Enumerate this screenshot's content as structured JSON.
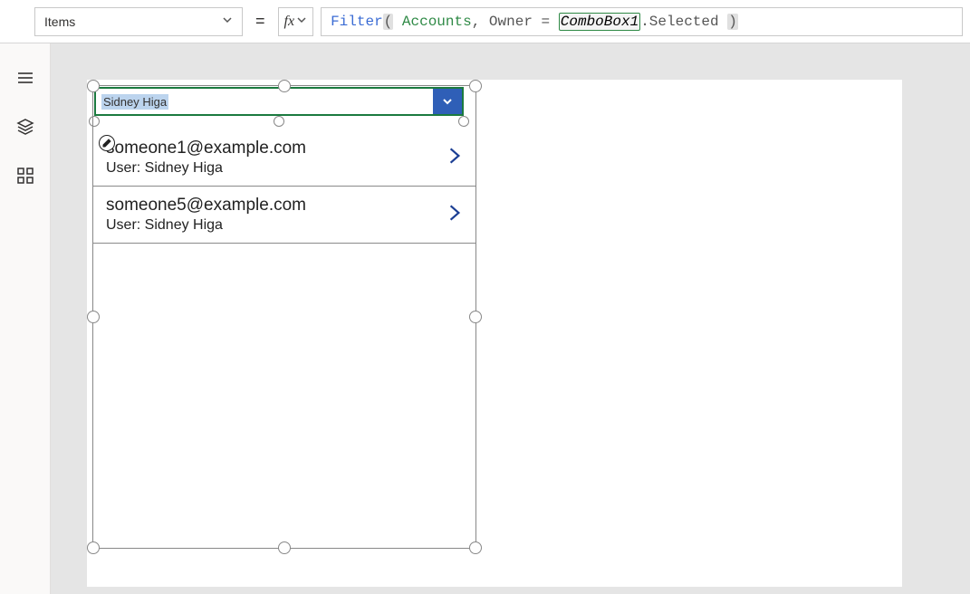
{
  "formulaBar": {
    "property": "Items",
    "equals": "=",
    "fxLabel": "fx",
    "formula": {
      "fn": "Filter",
      "openParen": "(",
      "arg1": "Accounts",
      "comma1": ",",
      "ownerKey": "Owner",
      "eq": "=",
      "comboRef": "ComboBox1",
      "dot": ".",
      "selectedProp": "Selected",
      "closeParen": ")"
    }
  },
  "leftRail": {
    "icons": [
      "hamburger-icon",
      "layers-icon",
      "apps-icon"
    ]
  },
  "combobox": {
    "selectedText": "Sidney Higa"
  },
  "gallery": {
    "items": [
      {
        "title": "someone1@example.com",
        "subtitle": "User: Sidney Higa",
        "showEditBadge": true
      },
      {
        "title": "someone5@example.com",
        "subtitle": "User: Sidney Higa",
        "showEditBadge": false
      }
    ]
  }
}
